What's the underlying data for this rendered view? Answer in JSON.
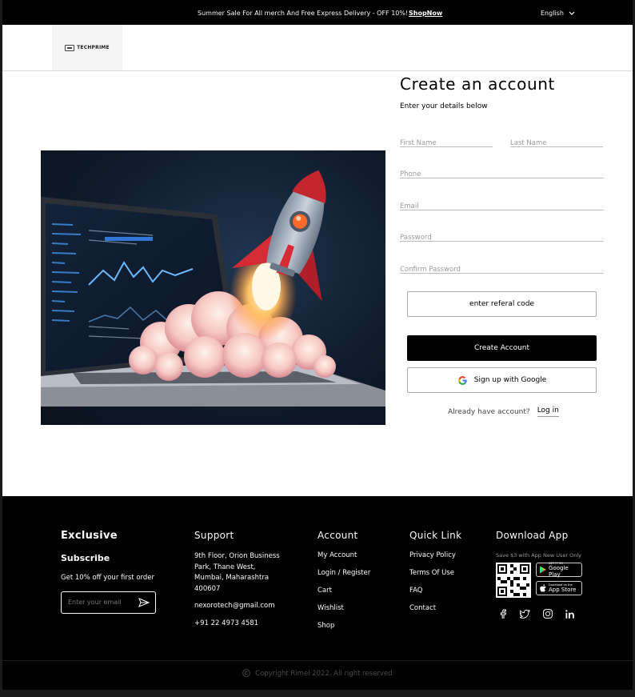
{
  "topbar": {
    "promo": "Summer Sale For All merch And Free Express Delivery - OFF 10%!",
    "shop_now": "ShopNow",
    "language": "English"
  },
  "header": {
    "logo_text": "TECHPRIME"
  },
  "form": {
    "title": "Create an account",
    "subtitle": "Enter your details below",
    "first_name_placeholder": "First Name",
    "last_name_placeholder": "Last Name",
    "phone_placeholder": "Phone",
    "email_placeholder": "Email",
    "password_placeholder": "Password",
    "confirm_password_placeholder": "Confirm Password",
    "referral_button": "enter referal code",
    "create_button": "Create Account",
    "google_button": "Sign up with Google",
    "have_account": "Already have account?",
    "login_link": "Log in"
  },
  "footer": {
    "exclusive": {
      "brand": "Exclusive",
      "subscribe": "Subscribe",
      "offer": "Get 10% off your first order",
      "email_placeholder": "Enter your email"
    },
    "support": {
      "title": "Support",
      "address": " 9th Floor, Orion Business Park,  Thane West, Mumbai, Maharashtra 400607",
      "email": "nexorotech@gmail.com",
      "phone": "+91 22 4973 4581"
    },
    "account": {
      "title": "Account",
      "links": [
        "My Account",
        "Login / Register",
        "Cart",
        "Wishlist",
        "Shop"
      ]
    },
    "quick_link": {
      "title": "Quick Link",
      "links": [
        "Privacy Policy",
        "Terms Of Use",
        "FAQ",
        "Contact"
      ]
    },
    "download": {
      "title": "Download App",
      "note": "Save $3 with App New User Only",
      "google_play_small": "GET IT ON",
      "google_play": "Google Play",
      "app_store_small": "Download on the",
      "app_store": "App Store"
    },
    "copyright": "Copyright Rimel 2022. All right reserved"
  },
  "icons": {
    "language_dropdown": "chevron-down-icon",
    "send": "send-icon",
    "google": "google-icon",
    "socials": [
      "facebook-icon",
      "twitter-icon",
      "instagram-icon",
      "linkedin-icon"
    ],
    "copyright": "copyright-icon"
  },
  "colors": {
    "topbar_bg": "#000000",
    "footer_bg": "#000000",
    "primary_button": "#000000",
    "page_bg": "#ffffff"
  }
}
